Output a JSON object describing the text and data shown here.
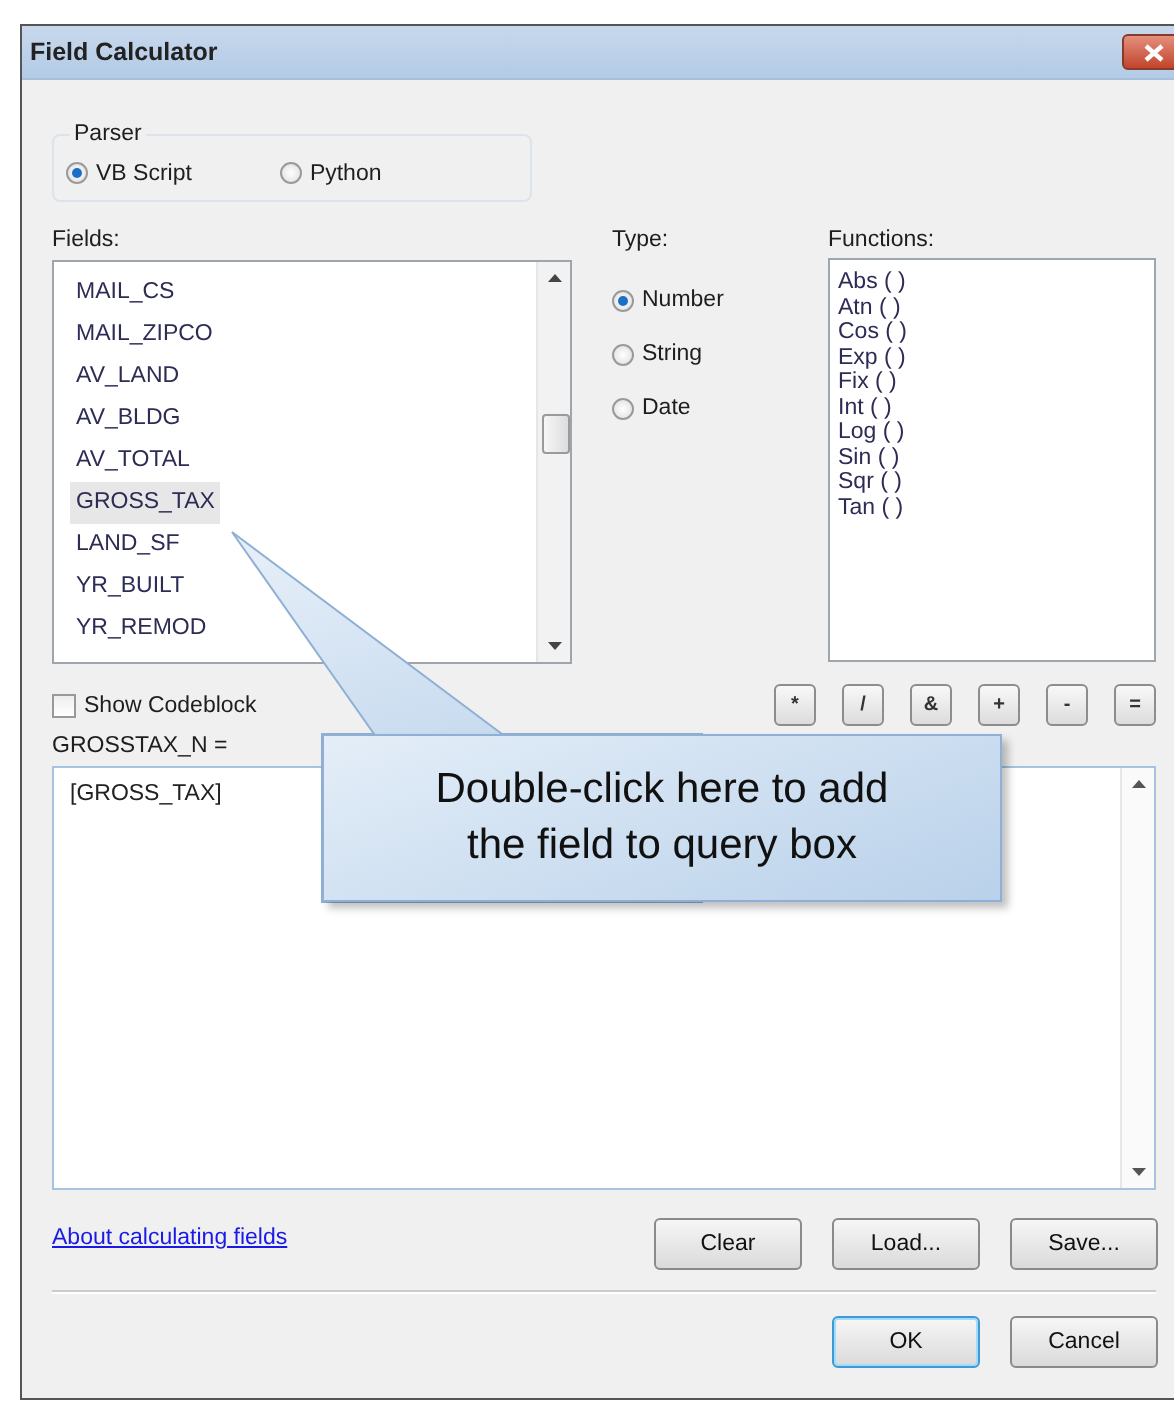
{
  "window": {
    "title": "Field Calculator"
  },
  "parser": {
    "label": "Parser",
    "options": [
      {
        "label": "VB Script",
        "selected": true
      },
      {
        "label": "Python",
        "selected": false
      }
    ]
  },
  "fields": {
    "label": "Fields:",
    "items": [
      {
        "name": "MAIL_CS",
        "selected": false
      },
      {
        "name": "MAIL_ZIPCO",
        "selected": false
      },
      {
        "name": "AV_LAND",
        "selected": false
      },
      {
        "name": "AV_BLDG",
        "selected": false
      },
      {
        "name": "AV_TOTAL",
        "selected": false
      },
      {
        "name": "GROSS_TAX",
        "selected": true
      },
      {
        "name": "LAND_SF",
        "selected": false
      },
      {
        "name": "YR_BUILT",
        "selected": false
      },
      {
        "name": "YR_REMOD",
        "selected": false
      }
    ]
  },
  "type": {
    "label": "Type:",
    "options": [
      {
        "label": "Number",
        "selected": true
      },
      {
        "label": "String",
        "selected": false
      },
      {
        "label": "Date",
        "selected": false
      }
    ]
  },
  "functions": {
    "label": "Functions:",
    "items": [
      "Abs ( )",
      "Atn ( )",
      "Cos ( )",
      "Exp ( )",
      "Fix ( )",
      "Int ( )",
      "Log ( )",
      "Sin ( )",
      "Sqr ( )",
      "Tan ( )"
    ]
  },
  "operators": [
    "*",
    "/",
    "&",
    "+",
    "-",
    "="
  ],
  "show_codeblock": {
    "label": "Show Codeblock",
    "checked": false
  },
  "expression": {
    "label": "GROSSTAX_N =",
    "value": "[GROSS_TAX]"
  },
  "link": "About calculating fields",
  "buttons": [
    "Clear",
    "Load...",
    "Save..."
  ],
  "dialog_buttons": [
    {
      "label": "OK",
      "default": true
    },
    {
      "label": "Cancel",
      "default": false
    }
  ],
  "callout": {
    "text": "Double-click here to add the field to query box"
  }
}
